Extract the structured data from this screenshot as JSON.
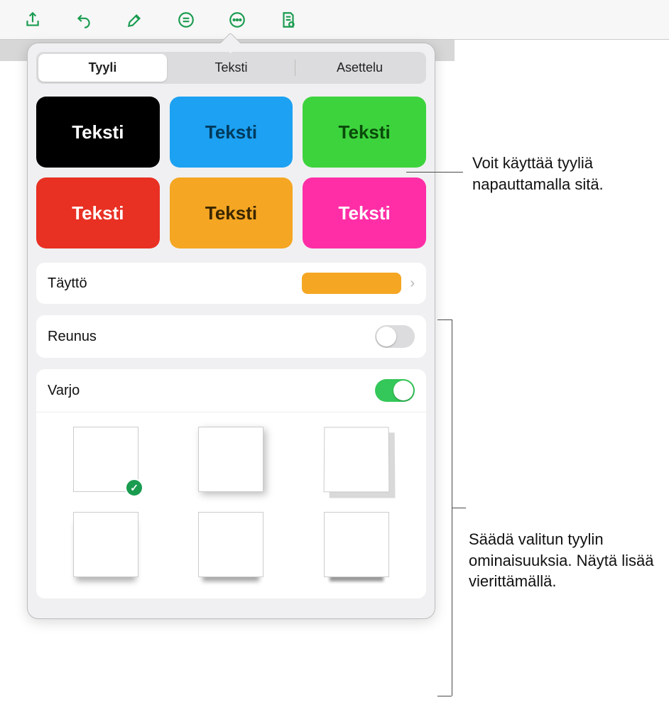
{
  "toolbar": {
    "icons": [
      "share-icon",
      "undo-icon",
      "brush-icon",
      "align-icon",
      "more-icon",
      "read-icon"
    ]
  },
  "tabs": {
    "style": "Tyyli",
    "text": "Teksti",
    "layout": "Asettelu",
    "active": "style"
  },
  "styles": [
    {
      "label": "Teksti",
      "bg": "#000000",
      "fg": "#ffffff"
    },
    {
      "label": "Teksti",
      "bg": "#1da1f2",
      "fg": "#003a5c"
    },
    {
      "label": "Teksti",
      "bg": "#3dd33d",
      "fg": "#0a4a0a"
    },
    {
      "label": "Teksti",
      "bg": "#e83023",
      "fg": "#ffffff"
    },
    {
      "label": "Teksti",
      "bg": "#f5a623",
      "fg": "#3a2600"
    },
    {
      "label": "Teksti",
      "bg": "#ff2ea6",
      "fg": "#ffffff"
    }
  ],
  "fill": {
    "label": "Täyttö",
    "color": "#f5a623"
  },
  "border": {
    "label": "Reunus",
    "on": false
  },
  "shadow": {
    "label": "Varjo",
    "on": true,
    "selected": 0
  },
  "callouts": {
    "top": "Voit käyttää tyyliä napauttamalla sitä.",
    "bottom": "Säädä valitun tyylin ominaisuuksia. Näytä lisää vierittämällä."
  }
}
